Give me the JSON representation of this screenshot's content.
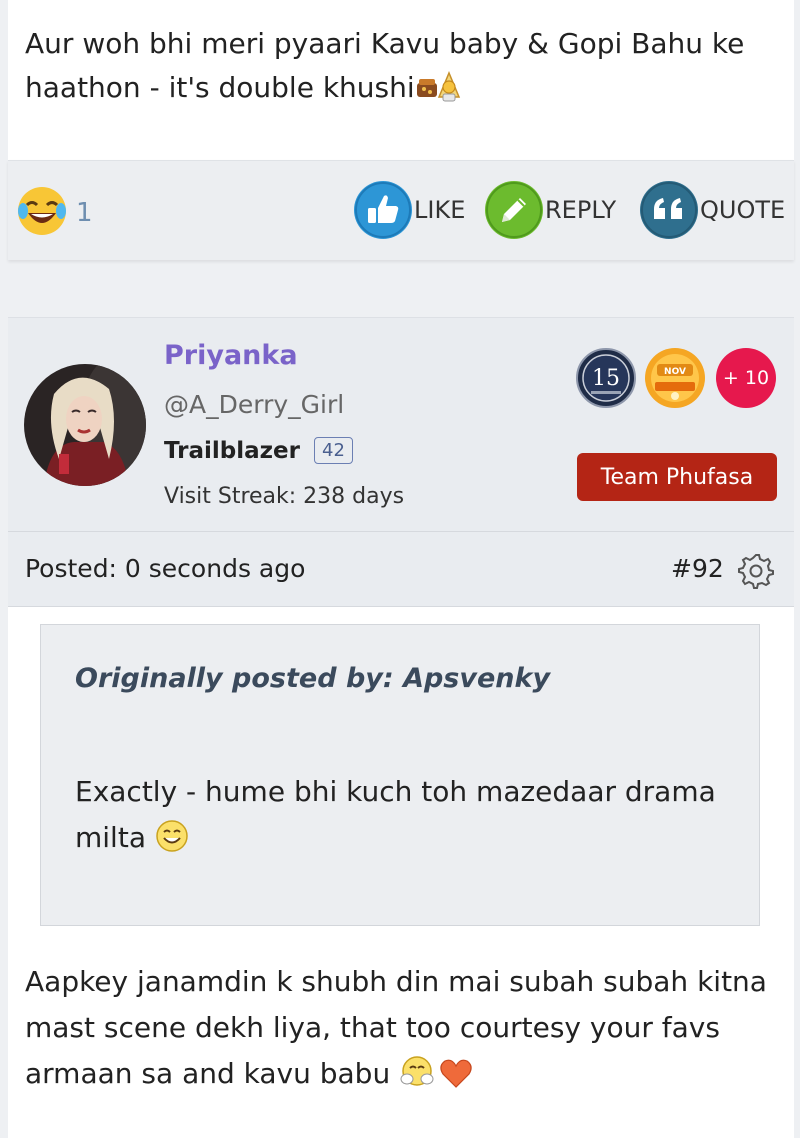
{
  "previous_post": {
    "text": "Aur woh bhi meri pyaari Kavu baby & Gopi Bahu ke haathon - it's double khushi",
    "emoji_icons": [
      "celebration-icon"
    ]
  },
  "reactions": {
    "icon": "laughing-emoji-icon",
    "count": "1"
  },
  "actions": {
    "like_label": "LIKE",
    "reply_label": "REPLY",
    "quote_label": "QUOTE"
  },
  "user": {
    "name": "Priyanka",
    "handle": "@A_Derry_Girl",
    "rank": "Trailblazer",
    "rank_level": "42",
    "visit_streak": "Visit Streak: 238 days",
    "badge_anniversary": "15",
    "badge_month": "NOV",
    "badge_more": "+ 10",
    "team_button": "Team Phufasa",
    "name_color": "#7a63c9",
    "team_color": "#b42515"
  },
  "post_meta": {
    "posted": "Posted: 0 seconds ago",
    "number": "#92"
  },
  "quote": {
    "author": "Originally posted by: Apsvenky",
    "text": "Exactly - hume bhi kuch toh mazedaar drama milta"
  },
  "reply": {
    "text": "Aapkey janamdin k shubh din mai subah subah kitna mast scene dekh liya, that too courtesy your favs armaan sa and kavu babu"
  }
}
